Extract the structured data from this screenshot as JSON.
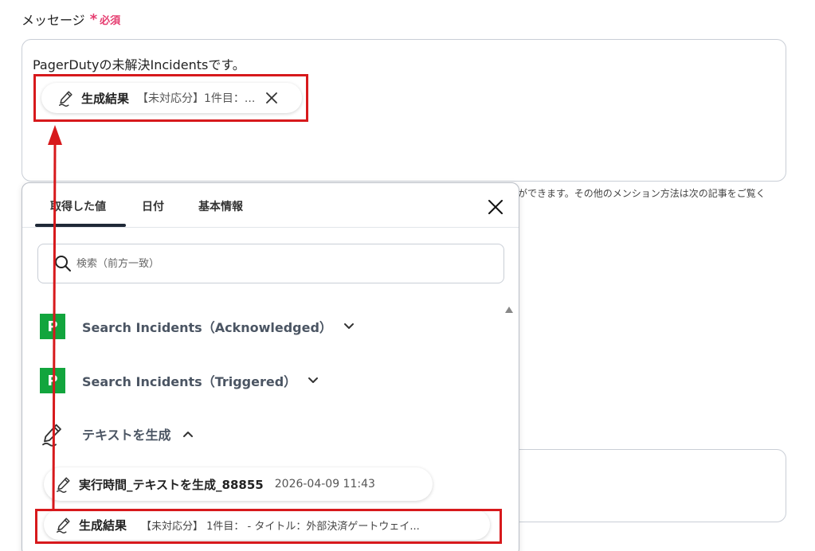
{
  "field": {
    "label": "メッセージ",
    "required_star": "*",
    "required_text": "必須"
  },
  "message": {
    "text": "PagerDutyの未解決Incidentsです。",
    "chip": {
      "icon": "pen-icon",
      "title": "生成結果",
      "value": "【未対応分】1件目：..."
    }
  },
  "hint": "がで​きます。その他のメンション方法は次の記事をご覧く",
  "popover": {
    "tabs": [
      {
        "label": "取得した値",
        "active": true
      },
      {
        "label": "日付",
        "active": false
      },
      {
        "label": "基本情報",
        "active": false
      }
    ],
    "search": {
      "placeholder": "検索（前方一致）"
    },
    "groups": [
      {
        "logo_letter": "P",
        "label": "Search Incidents（Acknowledged）",
        "expanded": false
      },
      {
        "logo_letter": "P",
        "label": "Search Incidents（Triggered）",
        "expanded": false
      },
      {
        "label": "テキストを生成",
        "expanded": true
      }
    ],
    "items": [
      {
        "title": "実行時間_テキストを生成_88855",
        "value": "2026-04-09 11:43"
      },
      {
        "title": "生成結果",
        "value": "【未対応分】 1件目： - タイトル：外部決済ゲートウェイ..."
      }
    ]
  },
  "colors": {
    "accent_required": "#e53c6f",
    "pagerduty_green": "#12a53d",
    "annotation_red": "#d7191c"
  }
}
